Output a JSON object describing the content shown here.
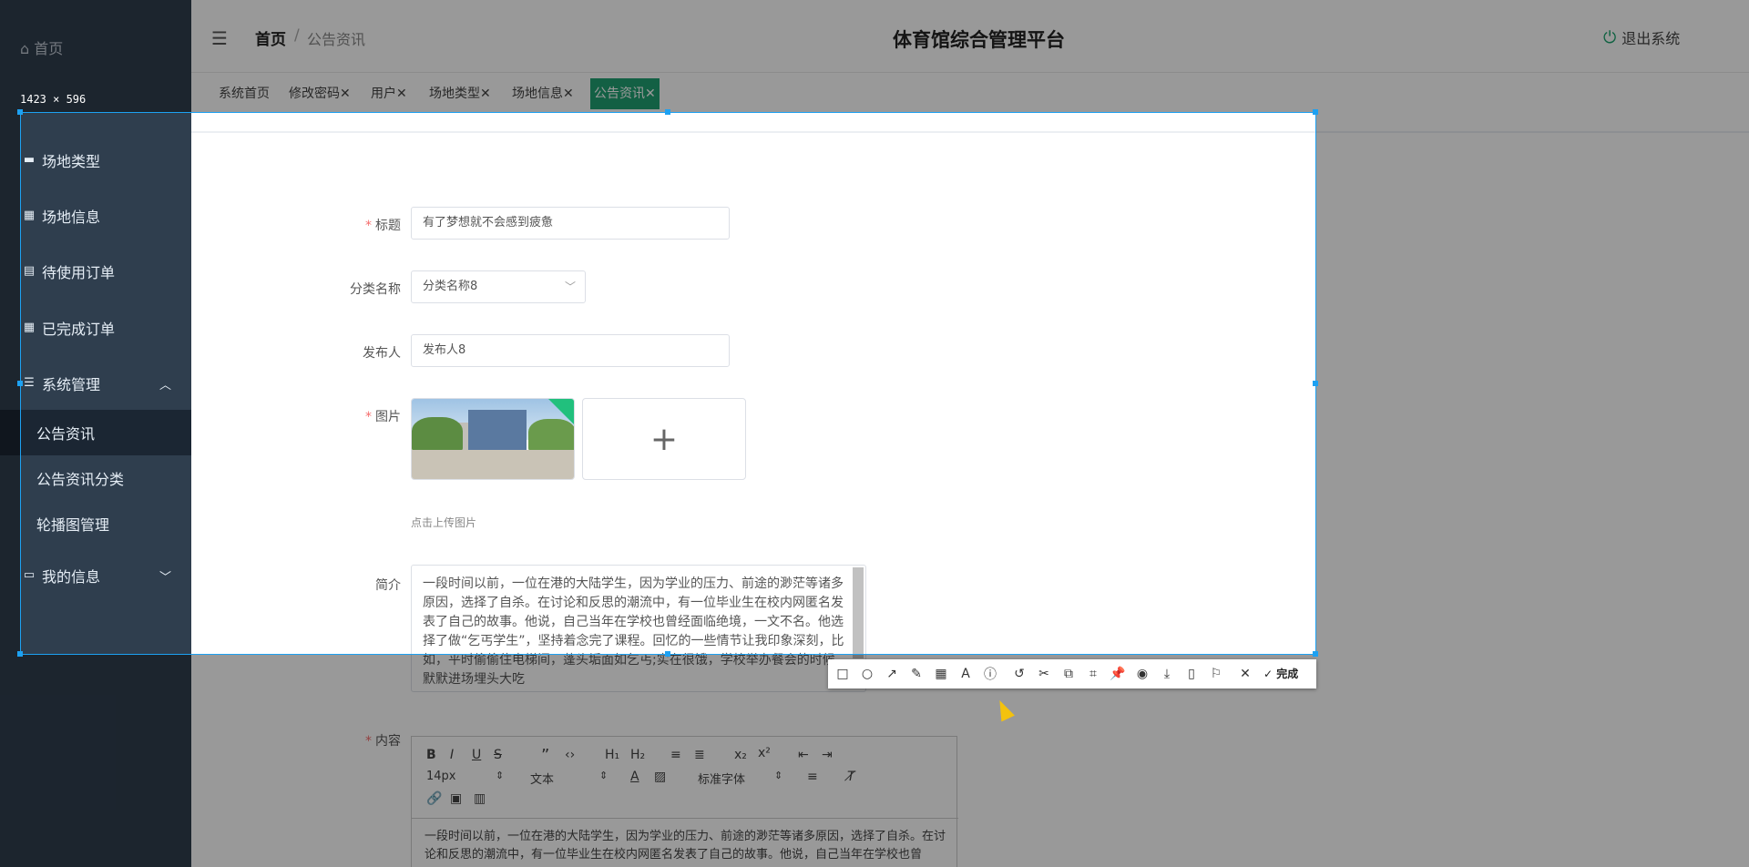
{
  "sidebar": {
    "home": "首页",
    "items": [
      {
        "label": "场地类型"
      },
      {
        "label": "场地信息"
      },
      {
        "label": "待使用订单"
      },
      {
        "label": "已完成订单"
      },
      {
        "label": "系统管理"
      },
      {
        "label": "我的信息"
      }
    ],
    "sub_items": [
      {
        "label": "公告资讯"
      },
      {
        "label": "公告资讯分类"
      },
      {
        "label": "轮播图管理"
      }
    ]
  },
  "header": {
    "breadcrumb_home": "首页",
    "breadcrumb_sep": "/",
    "breadcrumb_current": "公告资讯",
    "title": "体育馆综合管理平台",
    "logout": "退出系统"
  },
  "tabs": [
    {
      "label": "系统首页"
    },
    {
      "label": "修改密码✕"
    },
    {
      "label": "用户✕"
    },
    {
      "label": "场地类型✕"
    },
    {
      "label": "场地信息✕"
    },
    {
      "label": "公告资讯✕"
    }
  ],
  "form": {
    "title_label": "标题",
    "title_value": "有了梦想就不会感到疲惫",
    "category_label": "分类名称",
    "category_value": "分类名称8",
    "publisher_label": "发布人",
    "publisher_value": "发布人8",
    "image_label": "图片",
    "upload_tip": "点击上传图片",
    "intro_label": "简介",
    "intro_value": "一段时间以前，一位在港的大陆学生，因为学业的压力、前途的渺茫等诸多原因，选择了自杀。在讨论和反思的潮流中，有一位毕业生在校内网匿名发表了自己的故事。他说，自己当年在学校也曾经面临绝境，一文不名。他选择了做“乞丐学生”，坚持着念完了课程。回忆的一些情节让我印象深刻，比如，平时偷偷住电梯间，蓬头垢面如乞丐;实在很饿，学校举办餐会的时候，默默进场埋头大吃",
    "content_label": "内容",
    "content_value": "一段时间以前，一位在港的大陆学生，因为学业的压力、前途的渺茫等诸多原因，选择了自杀。在讨论和反思的潮流中，有一位毕业生在校内网匿名发表了自己的故事。他说，自己当年在学校也曾"
  },
  "editor_toolbar": {
    "font_size": "14px",
    "text_style": "文本",
    "font_family": "标准字体"
  },
  "screenshot_tool": {
    "dimensions": "1423 × 596",
    "done_label": "完成"
  },
  "colors": {
    "sidebar_bg": "#2f3e4e",
    "accent_green": "#21a172",
    "selection_blue": "#1da1f2"
  }
}
